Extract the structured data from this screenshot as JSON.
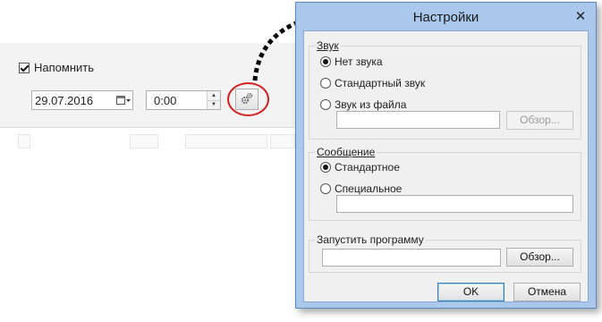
{
  "background": {
    "remind_label": "Напомнить",
    "remind_checked": true,
    "date_value": "29.07.2016",
    "time_value": "0:00"
  },
  "dialog": {
    "title": "Настройки",
    "close_glyph": "✕",
    "sound_group": {
      "legend": "Звук",
      "options": [
        "Нет звука",
        "Стандартный звук",
        "Звук из файла"
      ],
      "selected": 0,
      "file_value": "",
      "browse_label": "Обзор..."
    },
    "message_group": {
      "legend": "Сообщение",
      "options": [
        "Стандартное",
        "Специальное"
      ],
      "selected": 0,
      "custom_value": ""
    },
    "program_group": {
      "legend": "Запустить программу",
      "program_value": "",
      "browse_label": "Обзор..."
    },
    "ok_label": "OK",
    "cancel_label": "Отмена"
  },
  "colors": {
    "dialog_frame": "#a9c8ec",
    "annotation_circle": "#d42020",
    "arrow": "#000000"
  }
}
